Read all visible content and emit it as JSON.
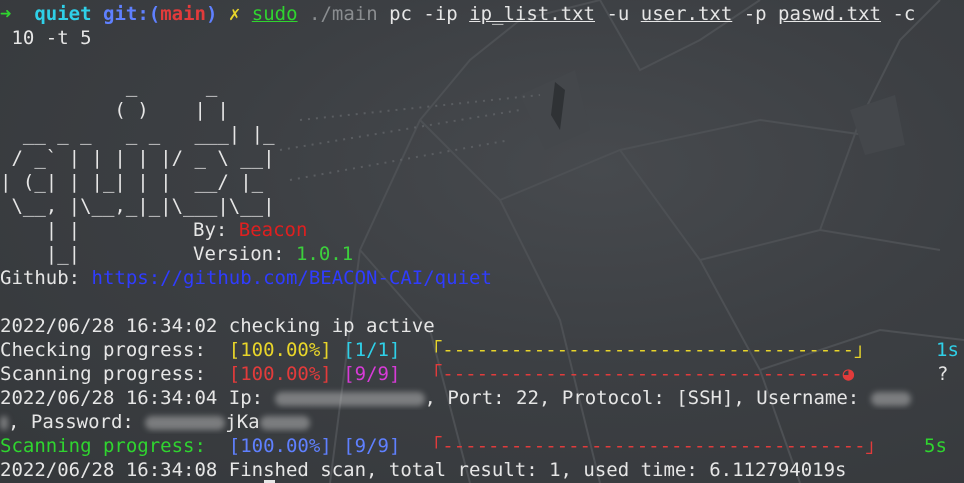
{
  "prompt": {
    "arrow": "➜",
    "dir": "quiet",
    "git_prefix": "git:(",
    "branch": "main",
    "git_suffix": ")",
    "dirty": "✗",
    "cmd_sudo": "sudo",
    "cmd_main": "./main",
    "arg_pc_ip": " pc -ip ",
    "ip_file": "ip_list.txt",
    "arg_u": " -u ",
    "user_file": "user.txt",
    "arg_p": " -p ",
    "pass_file": "paswd.txt",
    "arg_c": " -c",
    "wrap": " 10 -t 5"
  },
  "banner": {
    "art": [
      "           _      _",
      "          ( )    | |",
      "  __ _ _   _ _   ___| |_",
      " / _` | | | | |/ _ \\ __|",
      "| (_| | |_| | |  __/ |_",
      " \\__, |\\__,_|_|\\___|\\__|",
      "    | |",
      "    |_|"
    ],
    "by_label": "By: ",
    "by_value": "Beacon",
    "version_label": "Version: ",
    "version_value": "1.0.1",
    "github_label": "Github: ",
    "github_url": "https://github.com/BEACON-CAI/quiet"
  },
  "log": {
    "check_line": "2022/06/28 16:34:02 checking ip active",
    "checking_label": "Checking progress:  ",
    "checking_pct": "[100.00%]",
    "checking_count": "[1/1]",
    "checking_bar": "「------------------------------------」",
    "checking_time": "1s",
    "scanning1_label": "Scanning progress:  ",
    "scanning1_pct": "[100.00%]",
    "scanning1_count": "[9/9]",
    "scanning1_bar": "「-----------------------------------",
    "scanning1_spinner": "◕",
    "scanning1_time": "?",
    "result_ts": "2022/06/28 16:34:04 Ip: ",
    "result_mid": ", Port: 22, Protocol: [SSH], Username: ",
    "result_pw_prefix": ", Password: ",
    "result_pw_visible": "jKa",
    "scanning2_label": "Scanning progress:  ",
    "scanning2_pct": "[100.00%]",
    "scanning2_count": "[9/9]",
    "scanning2_bar": "「-------------------------------------」",
    "scanning2_time": "5s",
    "finish_line": "2022/06/28 16:34:08 Finshed scan, total result: 1, used time: 6.112794019s"
  }
}
